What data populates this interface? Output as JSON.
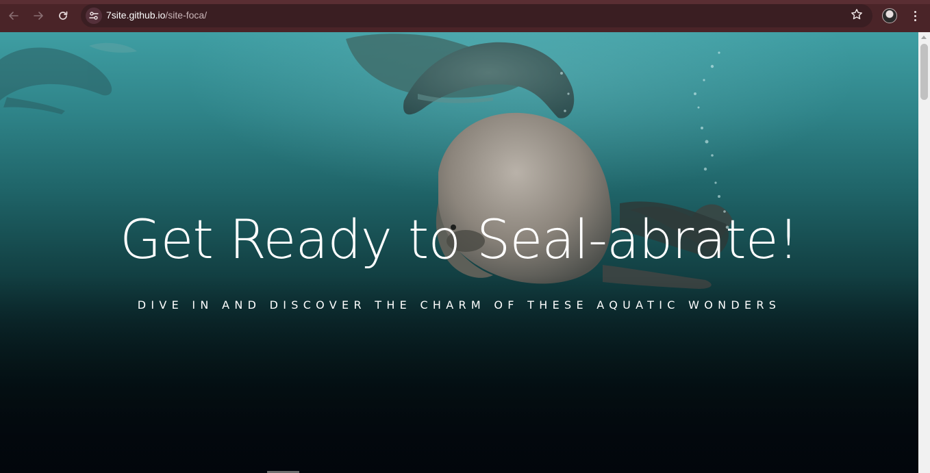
{
  "browser": {
    "back_icon": "arrow-left-icon",
    "forward_icon": "arrow-right-icon",
    "reload_icon": "reload-icon",
    "site_info_icon": "tune-icon",
    "url_host": "7site.github.io",
    "url_path": "/site-foca/",
    "bookmark_icon": "star-outline-icon",
    "profile_icon": "avatar-icon",
    "menu_icon": "kebab-menu-icon",
    "chrome_color": "#4a2428",
    "omnibox_color": "#3a1e22"
  },
  "hero": {
    "title": "Get Ready to Seal-abrate!",
    "subtitle": "DIVE IN AND DISCOVER THE CHARM OF THESE AQUATIC WONDERS",
    "background_image": "seals-swimming-underwater",
    "water_color_top": "#3f9ea3",
    "water_color_bottom": "#05090f"
  }
}
